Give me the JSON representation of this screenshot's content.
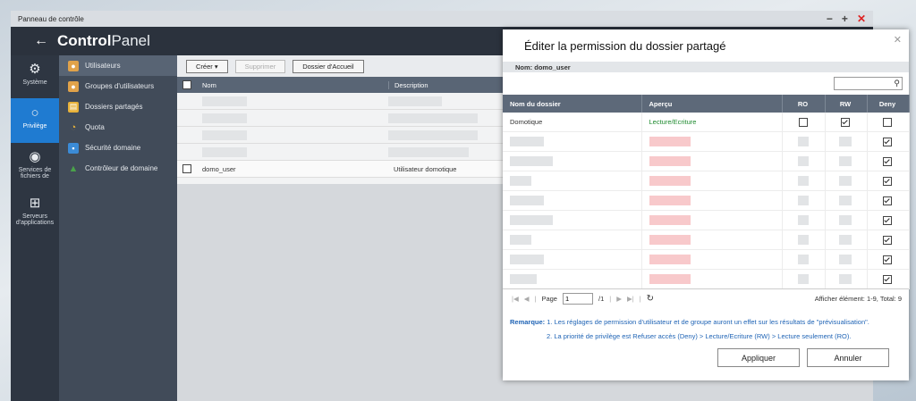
{
  "window": {
    "title": "Panneau de contrôle",
    "min": "−",
    "max": "+",
    "close": "✕"
  },
  "app": {
    "brand_bold": "Control",
    "brand_light": "Panel"
  },
  "nav": [
    {
      "label": "Système",
      "icon": "gear-icon",
      "glyph": "⚙"
    },
    {
      "label": "Privilège",
      "icon": "user-icon",
      "glyph": "👤"
    },
    {
      "label": "Services de fichiers de",
      "icon": "globe-icon",
      "glyph": "🌐"
    },
    {
      "label": "Serveurs d'applications",
      "icon": "apps-icon",
      "glyph": "⊞"
    }
  ],
  "subnav": [
    {
      "label": "Utilisateurs",
      "color": "#e0a24a"
    },
    {
      "label": "Groupes d'utilisateurs",
      "color": "#e0a24a"
    },
    {
      "label": "Dossiers partagés",
      "color": "#e8b23a"
    },
    {
      "label": "Quota",
      "color": "#2f8fd8"
    },
    {
      "label": "Sécurité domaine",
      "color": "#3b8bd6"
    },
    {
      "label": "Contrôleur de domaine",
      "color": "#4aa24a"
    }
  ],
  "toolbar": {
    "create": "Créer ▾",
    "delete": "Supprimer",
    "home": "Dossier d'Accueil"
  },
  "users_table": {
    "headers": [
      "Nom",
      "Description"
    ],
    "row": {
      "name": "domo_user",
      "description": "Utilisateur domotique"
    }
  },
  "dialog": {
    "title": "Éditer la permission du dossier partagé",
    "name_label": "Nom: domo_user",
    "search_placeholder": "",
    "headers": [
      "Nom du dossier",
      "Aperçu",
      "RO",
      "RW",
      "Deny"
    ],
    "rows": [
      {
        "folder": "Domotique",
        "preview": "Lecture/Ecriture",
        "ro": false,
        "rw": true,
        "deny": false
      }
    ],
    "hidden_rows_deny": [
      true,
      true,
      true,
      true,
      true,
      true,
      true,
      true
    ],
    "pager": {
      "page_label": "Page",
      "page_value": "1",
      "of": "/1",
      "total": "Afficher élément: 1-9, Total: 9"
    },
    "remark_label": "Remarque:",
    "remark1": "1. Les réglages de permission d'utilisateur et de groupe auront un effet sur les résultats de \"prévisualisation\".",
    "remark2": "2. La priorité de privilège est Refuser accès (Deny) > Lecture/Ecriture (RW) > Lecture seulement (RO).",
    "apply": "Appliquer",
    "cancel": "Annuler"
  }
}
